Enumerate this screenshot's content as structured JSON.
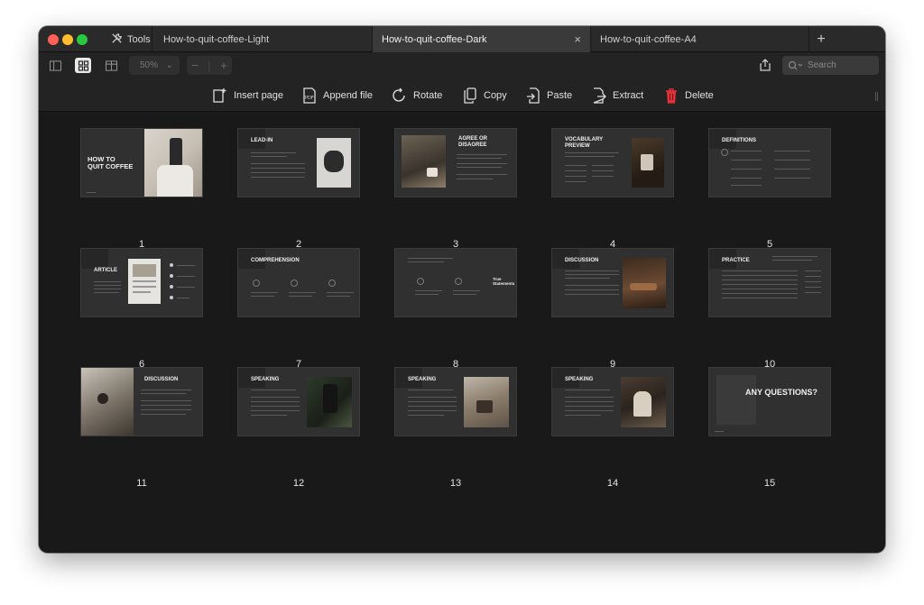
{
  "window": {
    "tools_label": "Tools",
    "tabs": [
      {
        "label": "How-to-quit-coffee-Light"
      },
      {
        "label": "How-to-quit-coffee-Dark",
        "close": "×"
      },
      {
        "label": "How-to-quit-coffee-A4"
      }
    ],
    "new_tab": "+"
  },
  "toolbar": {
    "zoom": "50%",
    "zoom_caret": "⌄",
    "zoom_out": "−",
    "zoom_in": "+",
    "search_placeholder": "Search"
  },
  "actions": {
    "insert_page": "Insert page",
    "append_file": "Append file",
    "rotate": "Rotate",
    "copy": "Copy",
    "paste": "Paste",
    "extract": "Extract",
    "delete": "Delete",
    "pdf_badge": "PDF"
  },
  "colors": {
    "delete_icon": "#e0313a",
    "background": "#191919",
    "slide": "#303030"
  },
  "pages": [
    {
      "number": "1",
      "title": "HOW TO\nQUIT COFFEE"
    },
    {
      "number": "2",
      "title": "LEAD-IN"
    },
    {
      "number": "3",
      "title": "AGREE OR\nDISAGREE"
    },
    {
      "number": "4",
      "title": "VOCABULARY\nPREVIEW"
    },
    {
      "number": "5",
      "title": "DEFINITIONS"
    },
    {
      "number": "6",
      "title": "ARTICLE"
    },
    {
      "number": "7",
      "title": "COMPREHENSION"
    },
    {
      "number": "8",
      "title": "True\nStatements"
    },
    {
      "number": "9",
      "title": "DISCUSSION"
    },
    {
      "number": "10",
      "title": "PRACTICE"
    },
    {
      "number": "11",
      "title": "DISCUSSION"
    },
    {
      "number": "12",
      "title": "SPEAKING"
    },
    {
      "number": "13",
      "title": "SPEAKING"
    },
    {
      "number": "14",
      "title": "SPEAKING"
    },
    {
      "number": "15",
      "title": "ANY QUESTIONS?"
    }
  ]
}
